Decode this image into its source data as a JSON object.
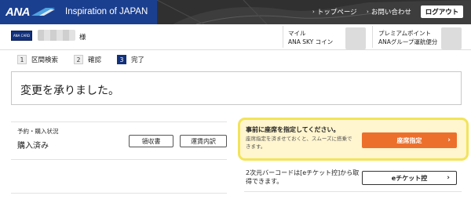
{
  "header": {
    "logo_text": "ANA",
    "tagline": "Inspiration of JAPAN",
    "nav": [
      {
        "label": "トップページ"
      },
      {
        "label": "お問い合わせ"
      }
    ],
    "logout_label": "ログアウト"
  },
  "user": {
    "card_label": "ANA CARD",
    "honorific": "様",
    "mile_label": "マイル",
    "coin_label": "ANA SKY コイン",
    "premium_label": "プレミアムポイント",
    "premium_sub": "ANAグループ運航便分"
  },
  "steps": [
    {
      "num": "1",
      "label": "区間検索"
    },
    {
      "num": "2",
      "label": "確認"
    },
    {
      "num": "3",
      "label": "完了"
    }
  ],
  "message": "変更を承りました。",
  "status": {
    "label": "予約・購入状況",
    "value": "購入済み",
    "receipt_button": "領収書",
    "fare_button": "運賃内訳"
  },
  "seat": {
    "title": "事前に座席を指定してください。",
    "description": "座席指定を済ませておくと、スムーズに搭乗できます。",
    "button": "座席指定"
  },
  "eticket": {
    "text": "2次元バーコードは[eチケット控]から取得できます。",
    "button": "eチケット控"
  },
  "colors": {
    "header_bg": "#1b3f8f",
    "accent_orange": "#ec6f2c",
    "highlight_border": "#f2e45a",
    "highlight_bg": "#fff5cf"
  }
}
